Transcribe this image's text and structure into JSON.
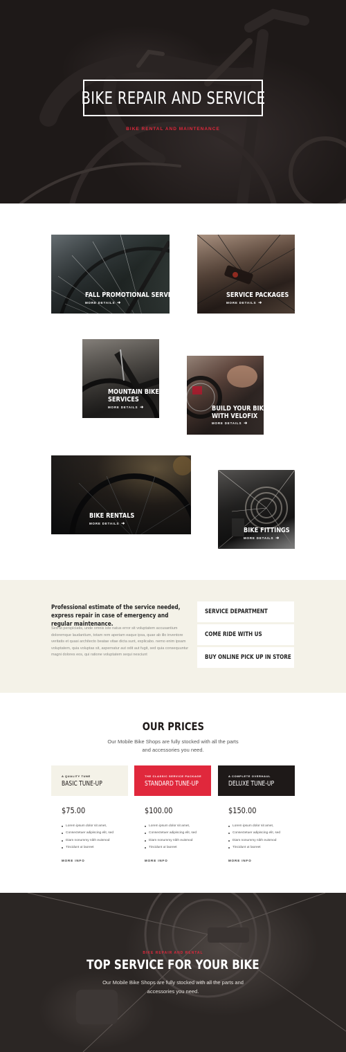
{
  "hero": {
    "title": "BIKE REPAIR AND SERVICE",
    "subtitle": "BIKE RENTAL AND MAINTENANCE"
  },
  "services": [
    {
      "title": "FALL PROMOTIONAL SERVICES",
      "more": "MORE DETAILS"
    },
    {
      "title": "SERVICE PACKAGES",
      "more": "MORE DETAILS"
    },
    {
      "title": "MOUNTAIN BIKE\nSERVICES",
      "more": "MORE DETAILS"
    },
    {
      "title": "BUILD YOUR BIKE\nWITH VELOFIX",
      "more": "MORE DETAILS"
    },
    {
      "title": "BIKE RENTALS",
      "more": "MORE DETAILS"
    },
    {
      "title": "BIKE FITTINGS",
      "more": "MORE DETAILS"
    }
  ],
  "info": {
    "heading": "Professional estimate of the service needed, express repair in case of emergency and regular maintenance.",
    "body": "Sed ut perspiciatis, unde omnis iste natus error sit voluptatem accusantium doloremque laudantium, totam rem aperiam eaque ipsa, quae ab illo inventore veritatis et quasi architecto beatae vitae dicta sunt, explicabo. nemo enim ipsam voluptatem, quia voluptas sit, aspernatur aut odit aut fugit, sed quia consequuntur magni dolores eos, qui ratione voluptatem sequi nesciunt",
    "links": [
      "SERVICE DEPARTMENT",
      "COME RIDE WITH US",
      "BUY ONLINE PICK UP IN STORE"
    ]
  },
  "prices": {
    "title": "OUR PRICES",
    "subtitle": "Our Mobile Bike Shops are fully stocked with all the parts and accessories you need.",
    "plans": [
      {
        "tag": "A QUALITY TUNE",
        "name": "BASIC TUNE-UP",
        "price": "$75.00",
        "features": [
          "Lorem ipsum dolor sit amet,",
          "Consectetuer adipiscing elit, sed",
          "Diam nonummy nibh euismod",
          "Tincidunt ut laoreet"
        ],
        "more": "MORE INFO",
        "bg": "#f4f2e8",
        "fg": "#1e1918"
      },
      {
        "tag": "THE CLASSIC SERVICE PACKAGE",
        "name": "STANDARD TUNE-UP",
        "price": "$100.00",
        "features": [
          "Lorem ipsum dolor sit amet,",
          "Consectetuer adipiscing elit, sed",
          "Diam nonummy nibh euismod",
          "Tincidunt ut laoreet"
        ],
        "more": "MORE INFO",
        "bg": "#e0283c",
        "fg": "#ffffff"
      },
      {
        "tag": "A COMPLETE OVERHAUL",
        "name": "DELUXE TUNE-UP",
        "price": "$150.00",
        "features": [
          "Lorem ipsum dolor sit amet,",
          "Consectetuer adipiscing elit, sed",
          "Diam nonummy nibh euismod",
          "Tincidunt ut laoreet"
        ],
        "more": "MORE INFO",
        "bg": "#1e1918",
        "fg": "#ffffff"
      }
    ]
  },
  "cta": {
    "tag": "BIKE REPAIR AND RENTAL",
    "title": "TOP SERVICE FOR YOUR BIKE",
    "subtitle": "Our Mobile Bike Shops are fully stocked with all the parts and accessories you need."
  },
  "colors": {
    "accent": "#e0283c",
    "dark": "#1e1918",
    "cream": "#f4f2e8"
  }
}
